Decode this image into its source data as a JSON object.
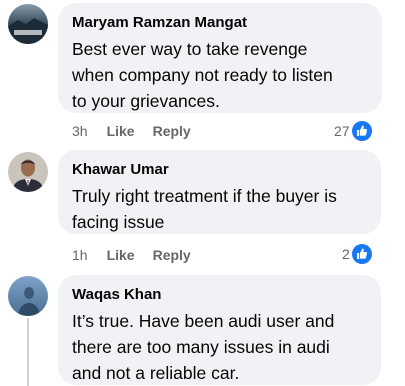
{
  "comments": [
    {
      "author": "Maryam Ramzan Mangat",
      "lines": [
        "Best ever way to take revenge",
        "when company not ready to listen",
        "to your grievances."
      ],
      "time": "3h",
      "like_label": "Like",
      "reply_label": "Reply",
      "reaction_count": "27"
    },
    {
      "author": "Khawar Umar",
      "lines": [
        "Truly right treatment if the buyer is",
        "facing issue"
      ],
      "time": "1h",
      "like_label": "Like",
      "reply_label": "Reply",
      "reaction_count": "2"
    },
    {
      "author": "Waqas Khan",
      "lines": [
        "It’s true. Have been audi user and",
        "there are too many issues in audi",
        "and not a reliable car."
      ]
    }
  ],
  "colors": {
    "bubble_bg": "#f0f2f5",
    "meta_text": "#65676b",
    "like_blue": "#1877f2"
  },
  "icons": {
    "reaction": "thumbs-up-icon"
  }
}
